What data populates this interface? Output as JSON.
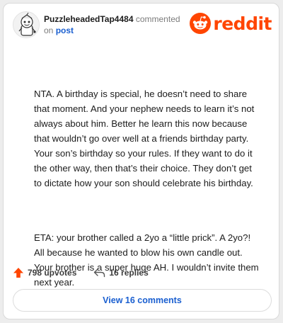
{
  "comment": {
    "username": "PuzzleheadedTap4484",
    "action_text": "commented",
    "preposition": "on",
    "post_link": "post",
    "avatar_icon": "snoo-avatar-icon",
    "paragraphs": [
      "NTA. A birthday is special, he doesn’t need to share that moment. And your nephew needs to learn it’s not always about him. Better he learn this now because that wouldn’t go over well at a friends birthday party. Your son’s birthday so your rules. If they want to do it the other way, then that’s their choice. They don’t get to dictate how your son should celebrate his birthday.",
      "ETA: your brother called a 2yo a “little prick”. A 2yo?! All because he wanted to blow his own candle out. Your brother is a super huge AH. I wouldn’t invite them next year."
    ]
  },
  "brand": {
    "wordmark": "reddit",
    "logo_icon": "reddit-snoo-icon",
    "color": "#ff4500"
  },
  "actions": {
    "upvotes_label": "798 upvotes",
    "upvote_icon": "upvote-arrow-icon",
    "upvote_color": "#ff4500",
    "replies_label": "16 replies",
    "reply_icon": "reply-arrow-icon"
  },
  "footer": {
    "view_comments_label": "View 16 comments",
    "link_color": "#1a5fd0"
  }
}
